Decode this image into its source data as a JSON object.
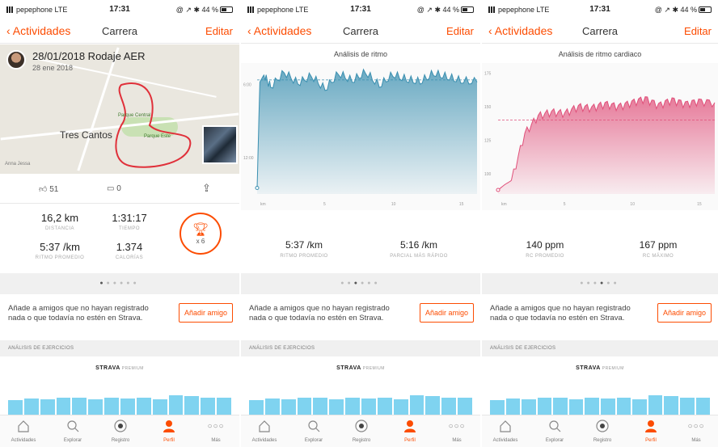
{
  "status": {
    "carrier": "pepephone  LTE",
    "time": "17:31",
    "right": "@ ↗ ✱ 44 %"
  },
  "common": {
    "back_label": "Actividades",
    "nav_title": "Carrera",
    "edit_label": "Editar",
    "invite_text": "Añade a amigos que no hayan registrado nada o que todavía no estén en Strava.",
    "add_friend": "Añadir amigo",
    "analysis_header": "ANÁLISIS DE EJERCICIOS",
    "premium_brand": "STRAVA",
    "premium_word": "PREMIUM",
    "tabs": [
      "Actividades",
      "Explorar",
      "Registro",
      "Perfil",
      "Más"
    ]
  },
  "screen1": {
    "activity_title": "28/01/2018 Rodaje AER",
    "activity_date": "28 ene 2018",
    "town": "Tres Cantos",
    "poi1": "Parque Central",
    "poi2": "Parque Este",
    "map_tag": "Anna Jessa",
    "kudos": "51",
    "comments": "0",
    "stats": [
      {
        "value": "16,2 km",
        "label": "DISTANCIA"
      },
      {
        "value": "1:31:17",
        "label": "TIEMPO"
      },
      {
        "value": "5:37 /km",
        "label": "RITMO PROMEDIO"
      },
      {
        "value": "1.374",
        "label": "CALORÍAS"
      }
    ],
    "trophy_count": "x 6",
    "active_dot": 0
  },
  "screen2": {
    "chart_title": "Análisis de ritmo",
    "stat_left_value": "5:37 /km",
    "stat_left_label": "RITMO PROMEDIO",
    "stat_right_value": "5:16 /km",
    "stat_right_label": "PARCIAL MÁS RÁPIDO",
    "active_dot": 2
  },
  "screen3": {
    "chart_title": "Análisis de ritmo cardiaco",
    "stat_left_value": "140 ppm",
    "stat_left_label": "RC PROMEDIO",
    "stat_right_value": "167 ppm",
    "stat_right_label": "RC MÁXIMO",
    "active_dot": 3
  },
  "chart_data": [
    {
      "type": "area",
      "title": "Análisis de ritmo",
      "y_ticks": [
        "6:00",
        "12:00"
      ],
      "x_ticks": [
        "km",
        "5",
        "10",
        "15"
      ],
      "xlim": [
        0,
        16.2
      ],
      "average_line": "5:37",
      "series": [
        {
          "x_km": [
            0,
            0.2,
            0.5,
            1,
            2,
            3,
            4,
            5,
            6,
            7,
            8,
            9,
            10,
            11,
            12,
            13,
            14,
            15,
            16.2
          ],
          "pace_min_per_km": [
            14.5,
            5.8,
            5.2,
            6.2,
            5.0,
            5.9,
            5.3,
            6.4,
            5.1,
            5.7,
            5.0,
            6.1,
            5.2,
            5.6,
            5.8,
            5.1,
            5.4,
            5.7,
            5.8
          ]
        }
      ],
      "color": "#3a8fb0"
    },
    {
      "type": "area",
      "title": "Análisis de ritmo cardiaco",
      "y_ticks": [
        "175",
        "150",
        "125",
        "100"
      ],
      "x_ticks": [
        "km",
        "5",
        "10",
        "15"
      ],
      "xlim": [
        0,
        16.2
      ],
      "ylim": [
        90,
        180
      ],
      "average_line": 140,
      "series": [
        {
          "x_km": [
            0,
            0.5,
            1,
            2,
            3,
            4,
            5,
            6,
            7,
            8,
            9,
            10,
            11,
            12,
            13,
            14,
            15,
            16.2
          ],
          "bpm": [
            88,
            92,
            95,
            130,
            143,
            146,
            145,
            150,
            149,
            152,
            150,
            153,
            156,
            151,
            155,
            152,
            154,
            153
          ]
        }
      ],
      "color": "#e0507a"
    }
  ]
}
